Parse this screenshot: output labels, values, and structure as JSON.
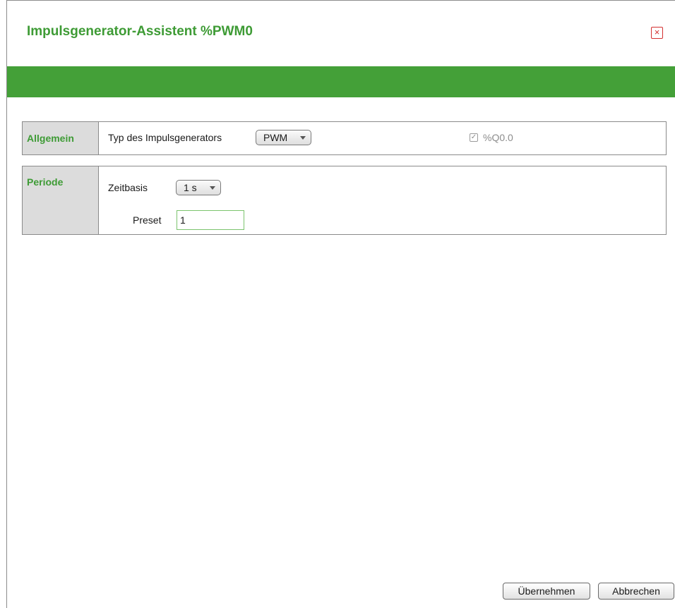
{
  "dialog": {
    "title": "Impulsgenerator-Assistent %PWM0",
    "close_symbol": "×"
  },
  "general": {
    "section_label": "Allgemein",
    "type_label": "Typ des Impulsgenerators",
    "type_value": "PWM",
    "output_checked": true,
    "output_check_symbol": "✓",
    "output_label": "%Q0.0"
  },
  "period": {
    "section_label": "Periode",
    "timebase_label": "Zeitbasis",
    "timebase_value": "1 s",
    "preset_label": "Preset",
    "preset_value": "1"
  },
  "footer": {
    "apply_label": "Übernehmen",
    "cancel_label": "Abbrechen"
  },
  "colors": {
    "accent_green": "#44a038",
    "title_green": "#3e9b35",
    "close_red": "#d43030"
  }
}
